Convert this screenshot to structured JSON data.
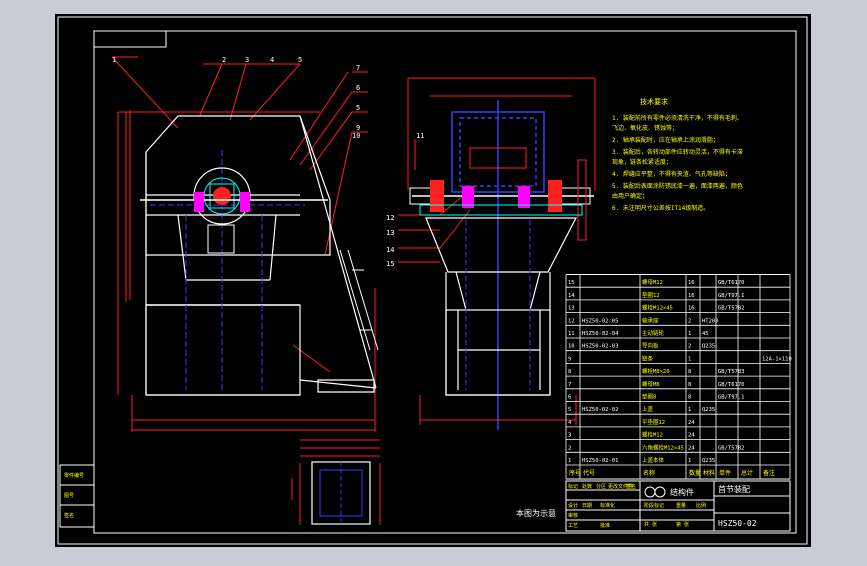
{
  "theme": {
    "background": "#c9ccd3",
    "sheet": "#000000",
    "frame": "#ffffff",
    "red": "#ff2020",
    "yellow": "#ffff00",
    "cyan": "#00ffff",
    "blue": "#3a3aff",
    "green": "#00ff00",
    "magenta": "#ff00ff"
  },
  "balloons": {
    "top_numbers": [
      "1",
      "2",
      "3",
      "4",
      "5"
    ],
    "right_numbers": [
      "7",
      "6",
      "5",
      "9",
      "10"
    ],
    "side_numbers": [
      "11",
      "12",
      "13",
      "14",
      "15"
    ]
  },
  "notes": {
    "title": "技术要求",
    "lines": [
      "1. 装配前所有零件必须清洗干净，不得有毛刺、",
      "   飞边、氧化皮、锈蚀等；",
      "2. 轴承装配时，应在轴承上涂润滑脂；",
      "3. 装配后，各转动部件应转动灵活，不得有卡滞",
      "   现象，链条松紧适度；",
      "4. 焊缝应平整，不得有夹渣、气孔等缺陷；",
      "5. 装配后表面涂防锈底漆一遍，面漆两遍，颜色",
      "   由用户确定；",
      "6. 未注明尺寸公差按IT14级制造。"
    ]
  },
  "view_label": "本图为示意",
  "bom": {
    "headers": [
      "序号",
      "代号",
      "名称",
      "数量",
      "材料",
      "单件",
      "总计",
      "备注"
    ],
    "rows": [
      [
        "15",
        "",
        "螺母M12",
        "16",
        "",
        "GB/T6170",
        "",
        ""
      ],
      [
        "14",
        "",
        "垫圈12",
        "16",
        "",
        "GB/T97.1",
        "",
        ""
      ],
      [
        "13",
        "",
        "螺栓M12×45",
        "16",
        "",
        "GB/T5782",
        "",
        ""
      ],
      [
        "12",
        "HSZ50-02-05",
        "轴承座",
        "2",
        "HT200",
        "",
        "",
        ""
      ],
      [
        "11",
        "HSZ50-02-04",
        "主动链轮",
        "1",
        "45",
        "",
        "",
        ""
      ],
      [
        "10",
        "HSZ50-02-03",
        "导向板",
        "2",
        "Q235",
        "",
        "",
        ""
      ],
      [
        "9",
        "",
        "链条",
        "1",
        "",
        "",
        "",
        "12A-1×110"
      ],
      [
        "8",
        "",
        "螺栓M8×20",
        "8",
        "",
        "GB/T5783",
        "",
        ""
      ],
      [
        "7",
        "",
        "螺母M8",
        "8",
        "",
        "GB/T6170",
        "",
        ""
      ],
      [
        "6",
        "",
        "垫圈8",
        "8",
        "",
        "GB/T97.1",
        "",
        ""
      ],
      [
        "5",
        "HSZ50-02-02",
        "上盖",
        "1",
        "Q235",
        "",
        "",
        ""
      ],
      [
        "4",
        "",
        "平垫圈12",
        "24",
        "",
        "",
        "",
        ""
      ],
      [
        "3",
        "",
        "螺栓M12",
        "24",
        "",
        "",
        "",
        ""
      ],
      [
        "2",
        "",
        "六角螺栓M12×45",
        "24",
        "",
        "GB/T5782",
        "",
        ""
      ],
      [
        "1",
        "HSZ50-02-01",
        "上盖本体",
        "1",
        "Q235",
        "",
        "",
        ""
      ]
    ]
  },
  "title_block": {
    "logo_text": "结构件",
    "assembly_name": "首节装配",
    "drawing_no": "HSZ50-02",
    "row_labels": [
      "标记",
      "处数",
      "分区",
      "更改文件号",
      "签名",
      "日期"
    ],
    "role_labels": [
      "设计",
      "审核",
      "工艺",
      "批准"
    ],
    "meta_labels": [
      "标准化",
      "阶段标记",
      "重量",
      "比例"
    ],
    "sheet_labels": [
      "共 张",
      "第 张"
    ]
  },
  "left_legend": [
    "零件编号",
    "图号",
    "签名"
  ]
}
